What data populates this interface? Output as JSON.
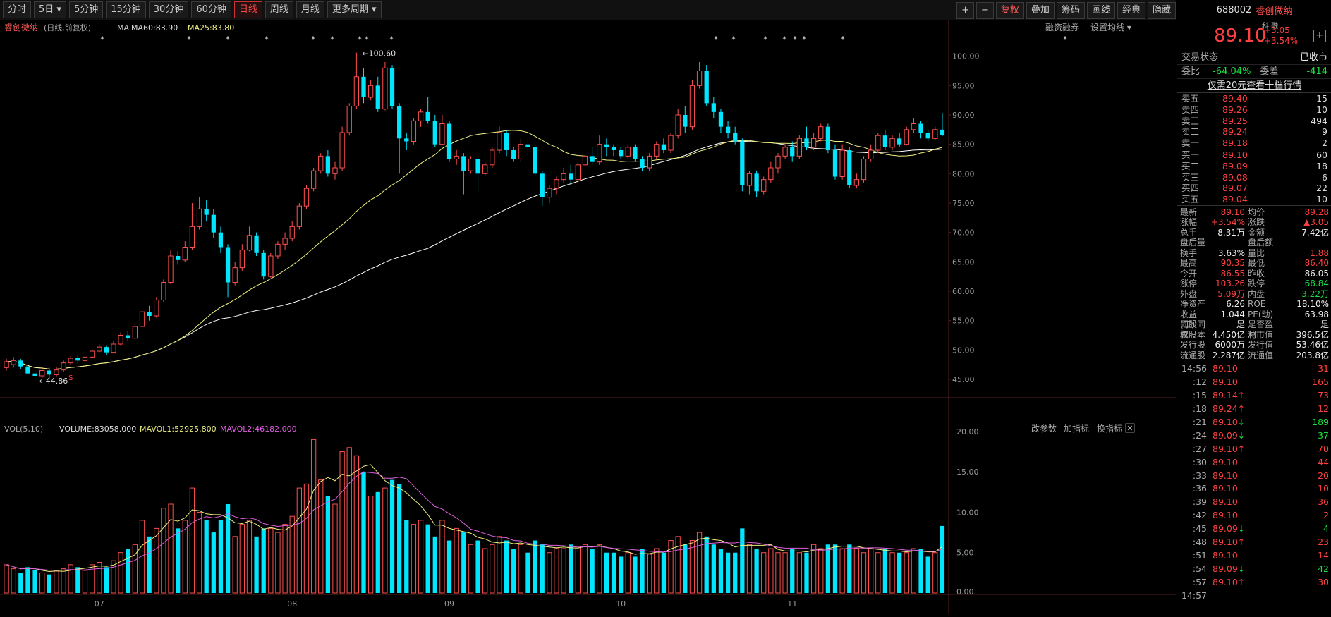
{
  "toolbar": {
    "periods": [
      "分时",
      "5日",
      "5分钟",
      "15分钟",
      "30分钟",
      "60分钟",
      "日线",
      "周线",
      "月线",
      "更多周期"
    ],
    "active_period": "日线",
    "right_buttons": [
      {
        "label": "+",
        "accent": false
      },
      {
        "label": "−",
        "accent": false
      },
      {
        "label": "复权",
        "accent": true
      },
      {
        "label": "叠加",
        "accent": false
      },
      {
        "label": "筹码",
        "accent": false
      },
      {
        "label": "画线",
        "accent": false
      },
      {
        "label": "经典",
        "accent": false
      },
      {
        "label": "隐藏",
        "accent": false
      }
    ]
  },
  "main_chart": {
    "stock_name": "睿创微纳",
    "mode": "(日线,前复权)",
    "ma_label": "MA",
    "ma60": "MA60:83.90",
    "ma25": "MA25:83.80",
    "right_links": [
      "融资融券",
      "设置均线"
    ],
    "high_label": "100.60",
    "low_label": "44.86",
    "price_ticks": [
      "100.00",
      "95.00",
      "90.00",
      "85.00",
      "80.00",
      "75.00",
      "70.00",
      "65.00",
      "60.00",
      "55.00",
      "50.00",
      "45.00"
    ],
    "colors": {
      "up": "#ff5050",
      "down": "#00e6ff",
      "ma_fast": "#f0f080",
      "ma_slow": "#ffffff"
    }
  },
  "volume_panel": {
    "title": "VOL(5,10)",
    "volume": "VOLUME:83058.000",
    "mavol1": "MAVOL1:52925.800",
    "mavol2": "MAVOL2:46182.000",
    "links": [
      "改参数",
      "加指标",
      "换指标"
    ],
    "ticks": [
      "20.00",
      "15.00",
      "10.00",
      "5.00"
    ],
    "unit": "0.00",
    "months": [
      "07",
      "08",
      "09",
      "10",
      "11"
    ]
  },
  "chart_data": {
    "type": "candlestick",
    "price_range": [
      42,
      102
    ],
    "candles": [
      [
        47.0,
        48.0,
        48.5,
        46.5
      ],
      [
        47.5,
        48.2,
        48.8,
        47.0
      ],
      [
        48.2,
        47.2,
        48.5,
        46.8
      ],
      [
        47.2,
        46.0,
        47.5,
        45.5
      ],
      [
        46.0,
        45.6,
        46.5,
        44.9
      ],
      [
        45.6,
        46.5,
        47.0,
        45.2
      ],
      [
        46.5,
        45.8,
        47.0,
        45.2
      ],
      [
        45.8,
        46.6,
        47.2,
        45.5
      ],
      [
        46.6,
        47.8,
        48.2,
        46.3
      ],
      [
        47.8,
        48.6,
        49.0,
        47.5
      ],
      [
        48.6,
        48.2,
        49.2,
        47.8
      ],
      [
        48.2,
        48.8,
        49.3,
        47.9
      ],
      [
        48.8,
        49.8,
        50.2,
        48.5
      ],
      [
        49.8,
        50.5,
        51.0,
        49.5
      ],
      [
        50.5,
        49.6,
        50.8,
        49.2
      ],
      [
        49.6,
        51.0,
        51.5,
        49.4
      ],
      [
        51.0,
        52.5,
        53.0,
        50.8
      ],
      [
        52.5,
        52.0,
        53.2,
        51.5
      ],
      [
        52.0,
        54.0,
        54.5,
        51.8
      ],
      [
        54.0,
        56.5,
        57.0,
        53.8
      ],
      [
        56.5,
        55.8,
        57.5,
        55.0
      ],
      [
        55.8,
        58.5,
        59.0,
        55.5
      ],
      [
        58.5,
        61.5,
        62.0,
        58.2
      ],
      [
        61.5,
        66.0,
        67.0,
        61.2
      ],
      [
        66.0,
        65.3,
        66.8,
        64.5
      ],
      [
        65.3,
        67.5,
        68.5,
        65.0
      ],
      [
        67.5,
        71.0,
        75.0,
        67.0
      ],
      [
        71.0,
        74.0,
        76.0,
        70.5
      ],
      [
        74.0,
        73.0,
        75.5,
        72.0
      ],
      [
        73.0,
        70.0,
        74.0,
        69.0
      ],
      [
        70.0,
        67.5,
        71.0,
        66.5
      ],
      [
        67.5,
        61.5,
        68.0,
        59.0
      ],
      [
        61.5,
        64.0,
        65.0,
        61.0
      ],
      [
        64.0,
        67.0,
        68.0,
        63.5
      ],
      [
        67.0,
        69.5,
        71.0,
        66.8
      ],
      [
        69.5,
        66.5,
        70.0,
        66.0
      ],
      [
        66.5,
        62.5,
        67.0,
        62.0
      ],
      [
        62.5,
        66.0,
        66.5,
        62.3
      ],
      [
        66.0,
        68.0,
        68.5,
        65.5
      ],
      [
        68.0,
        69.0,
        70.0,
        67.0
      ],
      [
        69.0,
        71.0,
        72.0,
        68.5
      ],
      [
        71.0,
        74.5,
        75.0,
        70.5
      ],
      [
        74.5,
        77.5,
        78.0,
        74.0
      ],
      [
        77.5,
        80.5,
        81.0,
        77.0
      ],
      [
        80.5,
        83.0,
        83.5,
        80.0
      ],
      [
        83.0,
        80.0,
        84.0,
        79.5
      ],
      [
        80.0,
        81.0,
        82.0,
        79.0
      ],
      [
        81.0,
        87.0,
        88.0,
        80.5
      ],
      [
        87.0,
        91.5,
        92.0,
        86.5
      ],
      [
        91.5,
        96.5,
        100.6,
        91.0
      ],
      [
        96.5,
        93.0,
        98.0,
        92.0
      ],
      [
        93.0,
        95.0,
        96.0,
        92.5
      ],
      [
        95.0,
        91.0,
        96.5,
        90.5
      ],
      [
        91.0,
        98.0,
        99.0,
        90.8
      ],
      [
        98.0,
        91.5,
        98.5,
        91.0
      ],
      [
        91.5,
        86.0,
        92.0,
        80.0
      ],
      [
        86.0,
        85.5,
        87.0,
        84.0
      ],
      [
        85.5,
        89.0,
        89.5,
        85.0
      ],
      [
        89.0,
        90.5,
        91.0,
        88.0
      ],
      [
        90.5,
        89.0,
        93.0,
        88.5
      ],
      [
        89.0,
        85.0,
        90.0,
        84.5
      ],
      [
        85.0,
        88.5,
        90.0,
        84.8
      ],
      [
        88.5,
        82.5,
        89.0,
        82.0
      ],
      [
        82.5,
        83.0,
        84.0,
        81.5
      ],
      [
        83.0,
        80.5,
        83.5,
        76.5
      ],
      [
        80.5,
        82.5,
        83.0,
        80.0
      ],
      [
        82.5,
        80.0,
        82.8,
        77.0
      ],
      [
        80.0,
        81.5,
        82.0,
        79.5
      ],
      [
        81.5,
        84.0,
        84.5,
        81.0
      ],
      [
        84.0,
        87.0,
        88.0,
        83.5
      ],
      [
        87.0,
        84.0,
        87.5,
        83.0
      ],
      [
        84.0,
        82.5,
        84.5,
        82.0
      ],
      [
        82.5,
        85.0,
        86.0,
        82.0
      ],
      [
        85.0,
        84.5,
        86.0,
        83.0
      ],
      [
        84.5,
        80.0,
        85.0,
        79.5
      ],
      [
        80.0,
        76.0,
        80.5,
        74.5
      ],
      [
        76.0,
        77.5,
        78.0,
        75.0
      ],
      [
        77.5,
        79.0,
        79.5,
        76.5
      ],
      [
        79.0,
        80.0,
        81.0,
        78.5
      ],
      [
        80.0,
        79.0,
        81.5,
        78.0
      ],
      [
        79.0,
        81.5,
        82.0,
        78.5
      ],
      [
        81.5,
        83.0,
        84.0,
        81.0
      ],
      [
        83.0,
        82.0,
        84.5,
        81.5
      ],
      [
        82.0,
        85.0,
        86.5,
        81.5
      ],
      [
        85.0,
        84.5,
        86.0,
        83.0
      ],
      [
        84.5,
        84.0,
        85.0,
        83.0
      ],
      [
        84.0,
        83.0,
        84.5,
        82.5
      ],
      [
        83.0,
        84.5,
        85.0,
        82.5
      ],
      [
        84.5,
        82.5,
        85.0,
        82.0
      ],
      [
        82.5,
        81.0,
        83.0,
        80.5
      ],
      [
        81.0,
        83.0,
        83.5,
        80.5
      ],
      [
        83.0,
        85.0,
        85.5,
        82.5
      ],
      [
        85.0,
        84.0,
        86.0,
        83.5
      ],
      [
        84.0,
        86.5,
        87.0,
        83.5
      ],
      [
        86.5,
        90.0,
        91.0,
        86.0
      ],
      [
        90.0,
        88.0,
        91.5,
        87.0
      ],
      [
        88.0,
        95.0,
        96.0,
        87.5
      ],
      [
        95.0,
        97.5,
        99.0,
        94.5
      ],
      [
        97.5,
        92.0,
        98.5,
        91.5
      ],
      [
        92.0,
        90.5,
        93.0,
        89.5
      ],
      [
        90.5,
        88.0,
        91.0,
        87.0
      ],
      [
        88.0,
        87.0,
        89.0,
        86.0
      ],
      [
        87.0,
        85.5,
        88.0,
        85.0
      ],
      [
        85.5,
        78.0,
        86.0,
        77.0
      ],
      [
        78.0,
        80.0,
        80.5,
        76.5
      ],
      [
        80.0,
        77.0,
        80.5,
        76.0
      ],
      [
        77.0,
        79.0,
        79.5,
        76.5
      ],
      [
        79.0,
        81.0,
        82.0,
        78.5
      ],
      [
        81.0,
        83.0,
        83.5,
        80.0
      ],
      [
        83.0,
        84.5,
        85.0,
        82.5
      ],
      [
        84.5,
        83.0,
        85.5,
        82.0
      ],
      [
        83.0,
        86.0,
        86.5,
        82.5
      ],
      [
        86.0,
        84.5,
        88.0,
        84.0
      ],
      [
        84.5,
        86.0,
        87.0,
        84.0
      ],
      [
        86.0,
        88.0,
        88.5,
        85.5
      ],
      [
        88.0,
        84.0,
        88.5,
        83.5
      ],
      [
        84.0,
        79.5,
        85.0,
        79.0
      ],
      [
        79.5,
        84.0,
        85.0,
        79.0
      ],
      [
        84.0,
        78.0,
        84.5,
        77.5
      ],
      [
        78.0,
        79.0,
        80.0,
        77.5
      ],
      [
        79.0,
        82.5,
        83.0,
        78.5
      ],
      [
        82.5,
        84.0,
        85.0,
        82.0
      ],
      [
        84.0,
        86.5,
        87.0,
        83.5
      ],
      [
        86.5,
        84.5,
        87.5,
        84.0
      ],
      [
        84.5,
        86.0,
        86.5,
        84.0
      ],
      [
        86.0,
        85.0,
        87.0,
        84.5
      ],
      [
        85.0,
        87.5,
        88.0,
        84.8
      ],
      [
        87.5,
        88.5,
        89.5,
        87.0
      ],
      [
        88.5,
        87.0,
        89.0,
        86.0
      ],
      [
        87.0,
        86.0,
        87.5,
        85.5
      ],
      [
        86.0,
        87.5,
        88.0,
        85.8
      ],
      [
        87.5,
        86.55,
        90.35,
        86.4
      ]
    ],
    "volumes": [
      3.5,
      3.0,
      2.5,
      3.2,
      2.8,
      2.5,
      2.3,
      2.8,
      3.0,
      3.5,
      3.2,
      2.8,
      3.5,
      3.8,
      3.2,
      4.0,
      5.0,
      5.5,
      6.0,
      9.0,
      7.0,
      8.0,
      10.5,
      11.0,
      8.0,
      9.0,
      13.0,
      10.0,
      9.0,
      7.5,
      9.0,
      11.0,
      7.0,
      8.5,
      9.0,
      7.0,
      8.0,
      8.0,
      7.5,
      8.5,
      9.5,
      13.0,
      13.5,
      19.0,
      14.0,
      12.0,
      11.0,
      17.5,
      18.0,
      17.0,
      15.0,
      12.0,
      12.5,
      13.0,
      14.0,
      13.5,
      9.0,
      8.5,
      9.0,
      8.5,
      7.0,
      9.0,
      6.5,
      8.0,
      7.5,
      6.0,
      6.5,
      5.5,
      6.0,
      7.0,
      6.5,
      5.5,
      6.0,
      5.0,
      6.5,
      6.0,
      5.0,
      5.5,
      5.5,
      6.0,
      5.8,
      6.0,
      5.5,
      6.0,
      5.0,
      5.0,
      4.5,
      5.0,
      4.5,
      5.5,
      4.8,
      5.5,
      5.0,
      6.5,
      7.0,
      6.0,
      6.5,
      7.5,
      7.0,
      6.0,
      5.5,
      5.0,
      5.0,
      8.0,
      6.0,
      5.5,
      5.0,
      5.5,
      5.0,
      5.0,
      5.5,
      5.0,
      5.0,
      6.0,
      5.5,
      6.0,
      6.0,
      5.5,
      6.0,
      5.5,
      5.0,
      5.5,
      5.0,
      5.5,
      5.0,
      5.0,
      5.0,
      5.5,
      5.5,
      4.5,
      5.0,
      8.3
    ],
    "vol_range": [
      0,
      22
    ]
  },
  "quote": {
    "code": "688002",
    "name": "睿创微纳",
    "price": "89.10",
    "tags": "科 融",
    "change": "+3.05",
    "change_pct": "+3.54%",
    "status_label": "交易状态",
    "status_value": "已收市",
    "weibi_label": "委比",
    "weibi": "-64.04%",
    "weicha_label": "委差",
    "weicha": "-414",
    "promo": "仅需20元查看十档行情",
    "asks": [
      {
        "label": "卖五",
        "price": "89.40",
        "vol": "15"
      },
      {
        "label": "卖四",
        "price": "89.26",
        "vol": "10"
      },
      {
        "label": "卖三",
        "price": "89.25",
        "vol": "494"
      },
      {
        "label": "卖二",
        "price": "89.24",
        "vol": "9"
      },
      {
        "label": "卖一",
        "price": "89.18",
        "vol": "2"
      }
    ],
    "bids": [
      {
        "label": "买一",
        "price": "89.10",
        "vol": "60"
      },
      {
        "label": "买二",
        "price": "89.09",
        "vol": "18"
      },
      {
        "label": "买三",
        "price": "89.08",
        "vol": "6"
      },
      {
        "label": "买四",
        "price": "89.07",
        "vol": "22"
      },
      {
        "label": "买五",
        "price": "89.04",
        "vol": "10"
      }
    ],
    "stats": [
      {
        "k1": "最新",
        "v1": "89.10",
        "c1": "red",
        "k2": "均价",
        "v2": "89.28",
        "c2": "red"
      },
      {
        "k1": "涨幅",
        "v1": "+3.54%",
        "c1": "red",
        "k2": "涨跌",
        "v2": "▲3.05",
        "c2": "red"
      },
      {
        "k1": "总手",
        "v1": "8.31万",
        "c1": "white",
        "k2": "金额",
        "v2": "7.42亿",
        "c2": "white"
      },
      {
        "k1": "盘后量",
        "v1": "",
        "c1": "white",
        "k2": "盘后额",
        "v2": "—",
        "c2": "white"
      },
      {
        "k1": "换手",
        "v1": "3.63%",
        "c1": "white",
        "k2": "量比",
        "v2": "1.88",
        "c2": "red"
      },
      {
        "k1": "最高",
        "v1": "90.35",
        "c1": "red",
        "k2": "最低",
        "v2": "86.40",
        "c2": "red"
      },
      {
        "k1": "今开",
        "v1": "86.55",
        "c1": "red",
        "k2": "昨收",
        "v2": "86.05",
        "c2": "white"
      },
      {
        "k1": "涨停",
        "v1": "103.26",
        "c1": "red",
        "k2": "跌停",
        "v2": "68.84",
        "c2": "green"
      },
      {
        "k1": "外盘",
        "v1": "5.09万",
        "c1": "red",
        "k2": "内盘",
        "v2": "3.22万",
        "c2": "green"
      },
      {
        "k1": "净资产",
        "v1": "6.26",
        "c1": "white",
        "k2": "ROE",
        "v2": "18.10%",
        "c2": "white"
      },
      {
        "k1": "收益(三)",
        "v1": "1.044",
        "c1": "white",
        "k2": "PE(动)",
        "v2": "63.98",
        "c2": "white"
      },
      {
        "k1": "同股同权",
        "v1": "是",
        "c1": "white",
        "k2": "是否盈利",
        "v2": "是",
        "c2": "white"
      },
      {
        "k1": "总股本",
        "v1": "4.450亿",
        "c1": "white",
        "k2": "总市值",
        "v2": "396.5亿",
        "c2": "white"
      },
      {
        "k1": "发行股",
        "v1": "6000万",
        "c1": "white",
        "k2": "发行值",
        "v2": "53.46亿",
        "c2": "white"
      },
      {
        "k1": "流通股",
        "v1": "2.287亿",
        "c1": "white",
        "k2": "流通值",
        "v2": "203.8亿",
        "c2": "white"
      }
    ],
    "ticks": [
      {
        "t": "14:56",
        "p": "89.10",
        "arr": "",
        "v": "31",
        "c": "red"
      },
      {
        "t": ":12",
        "p": "89.10",
        "arr": "",
        "v": "165",
        "c": "red"
      },
      {
        "t": ":15",
        "p": "89.14",
        "arr": "↑",
        "v": "73",
        "c": "red"
      },
      {
        "t": ":18",
        "p": "89.24",
        "arr": "↑",
        "v": "12",
        "c": "red"
      },
      {
        "t": ":21",
        "p": "89.10",
        "arr": "↓",
        "v": "189",
        "c": "green"
      },
      {
        "t": ":24",
        "p": "89.09",
        "arr": "↓",
        "v": "37",
        "c": "green"
      },
      {
        "t": ":27",
        "p": "89.10",
        "arr": "↑",
        "v": "70",
        "c": "red"
      },
      {
        "t": ":30",
        "p": "89.10",
        "arr": "",
        "v": "44",
        "c": "red"
      },
      {
        "t": ":33",
        "p": "89.10",
        "arr": "",
        "v": "20",
        "c": "red"
      },
      {
        "t": ":36",
        "p": "89.10",
        "arr": "",
        "v": "10",
        "c": "red"
      },
      {
        "t": ":39",
        "p": "89.10",
        "arr": "",
        "v": "36",
        "c": "red"
      },
      {
        "t": ":42",
        "p": "89.10",
        "arr": "",
        "v": "2",
        "c": "red"
      },
      {
        "t": ":45",
        "p": "89.09",
        "arr": "↓",
        "v": "4",
        "c": "green"
      },
      {
        "t": ":48",
        "p": "89.10",
        "arr": "↑",
        "v": "23",
        "c": "red"
      },
      {
        "t": ":51",
        "p": "89.10",
        "arr": "",
        "v": "14",
        "c": "red"
      },
      {
        "t": ":54",
        "p": "89.09",
        "arr": "↓",
        "v": "42",
        "c": "green"
      },
      {
        "t": ":57",
        "p": "89.10",
        "arr": "↑",
        "v": "30",
        "c": "red"
      },
      {
        "t": "14:57",
        "p": "",
        "arr": "",
        "v": "",
        "c": "red"
      }
    ]
  }
}
